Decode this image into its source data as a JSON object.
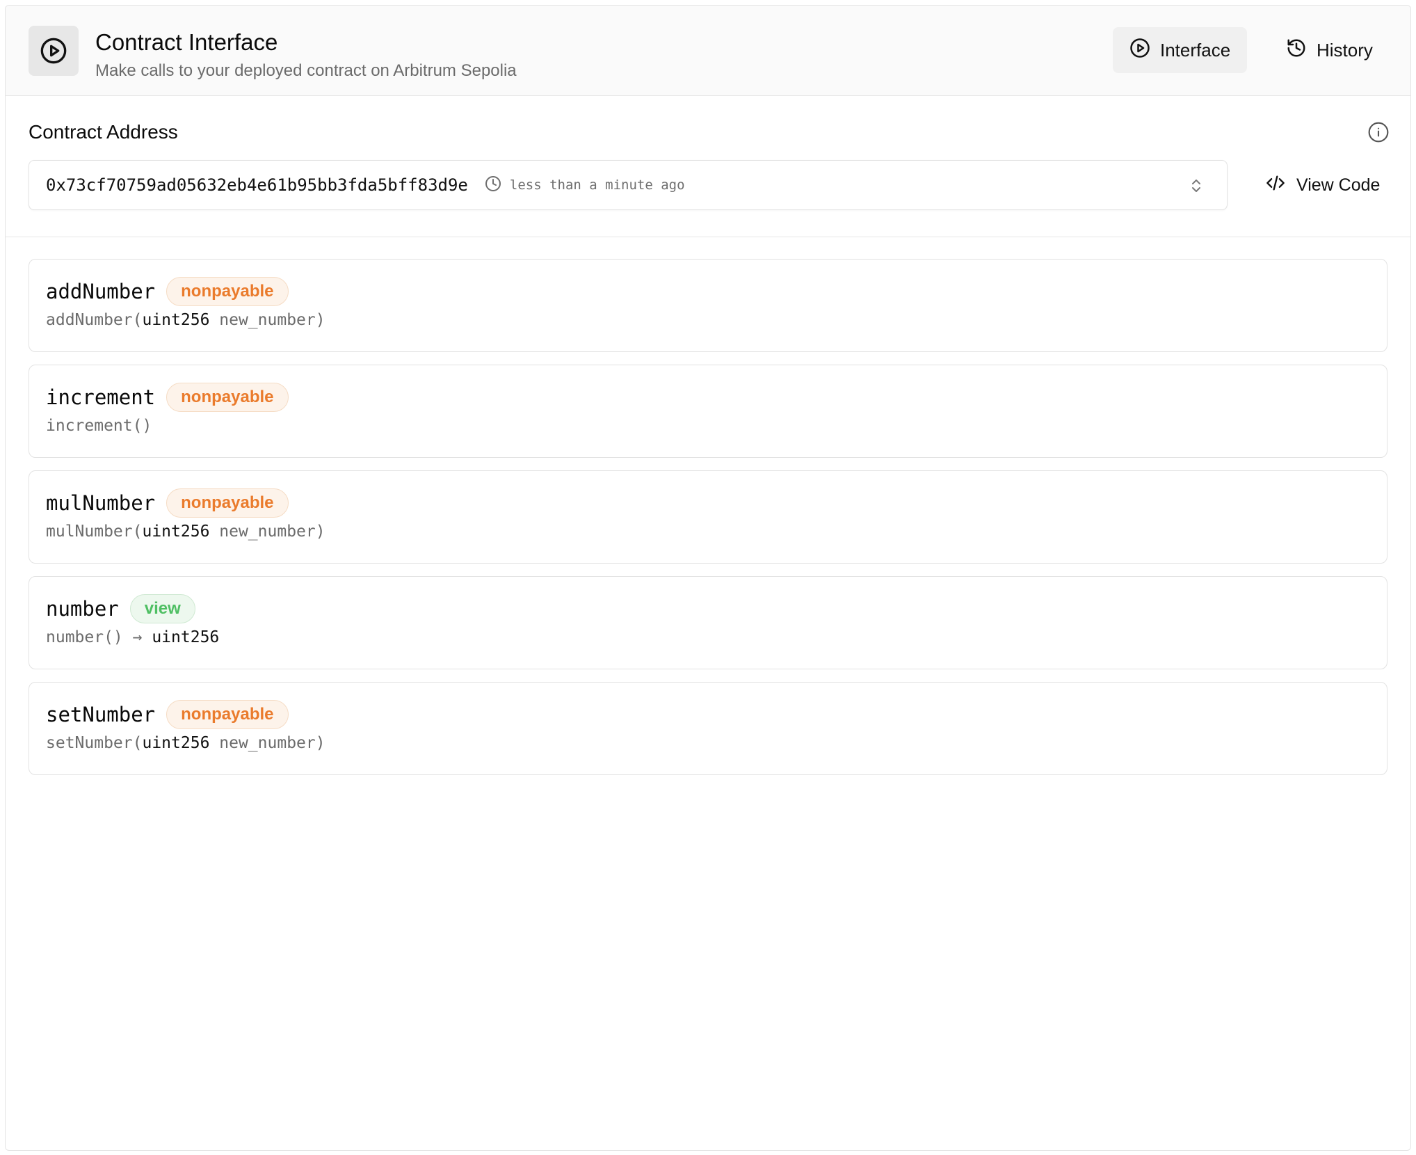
{
  "header": {
    "title": "Contract Interface",
    "subtitle": "Make calls to your deployed contract on Arbitrum Sepolia",
    "tabs": [
      {
        "label": "Interface",
        "icon": "play-circle-icon",
        "active": true
      },
      {
        "label": "History",
        "icon": "history-icon",
        "active": false
      }
    ]
  },
  "address": {
    "label": "Contract Address",
    "value": "0x73cf70759ad05632eb4e61b95bb3fda5bff83d9e",
    "time": "less than a minute ago",
    "view_code_label": "View Code"
  },
  "functions": [
    {
      "name": "addNumber",
      "mutability": "nonpayable",
      "sig_name": "addNumber(",
      "param_type": "uint256",
      "param_name": " new_number",
      "sig_end": ")"
    },
    {
      "name": "increment",
      "mutability": "nonpayable",
      "sig_name": "increment()",
      "param_type": "",
      "param_name": "",
      "sig_end": ""
    },
    {
      "name": "mulNumber",
      "mutability": "nonpayable",
      "sig_name": "mulNumber(",
      "param_type": "uint256",
      "param_name": " new_number",
      "sig_end": ")"
    },
    {
      "name": "number",
      "mutability": "view",
      "sig_name": "number() → ",
      "param_type": "uint256",
      "param_name": "",
      "sig_end": ""
    },
    {
      "name": "setNumber",
      "mutability": "nonpayable",
      "sig_name": "setNumber(",
      "param_type": "uint256",
      "param_name": " new_number",
      "sig_end": ")"
    }
  ],
  "colors": {
    "nonpayable": "#ea7b2c",
    "view": "#4fbf63"
  }
}
